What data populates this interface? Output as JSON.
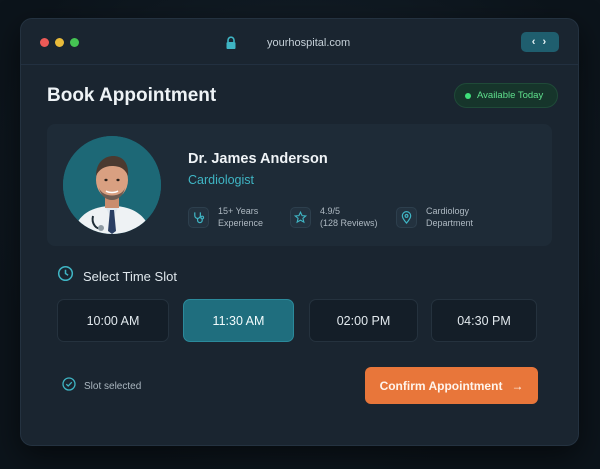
{
  "browser": {
    "url": "yourhospital.com",
    "nav_label": "‹ ›"
  },
  "page": {
    "title": "Book Appointment",
    "badge": "Available Today"
  },
  "doctor": {
    "name": "Dr. James Anderson",
    "specialty": "Cardiologist",
    "stats": [
      {
        "icon": "stethoscope-icon",
        "line1": "15+ Years",
        "line2": "Experience"
      },
      {
        "icon": "star-icon",
        "line1": "4.9/5",
        "line2": "(128 Reviews)"
      },
      {
        "icon": "location-pin-icon",
        "line1": "Cardiology",
        "line2": "Department"
      }
    ]
  },
  "slots": {
    "header": "Select Time Slot",
    "items": [
      "10:00 AM",
      "11:30 AM",
      "02:00 PM",
      "04:30 PM"
    ],
    "selected": "11:30 AM"
  },
  "footer": {
    "status": "Slot selected",
    "confirm_label": "Confirm Appointment",
    "confirm_arrow": "→"
  },
  "colors": {
    "accent": "#1f6e7e",
    "cta": "#e8763a",
    "available": "#3ee07a"
  }
}
